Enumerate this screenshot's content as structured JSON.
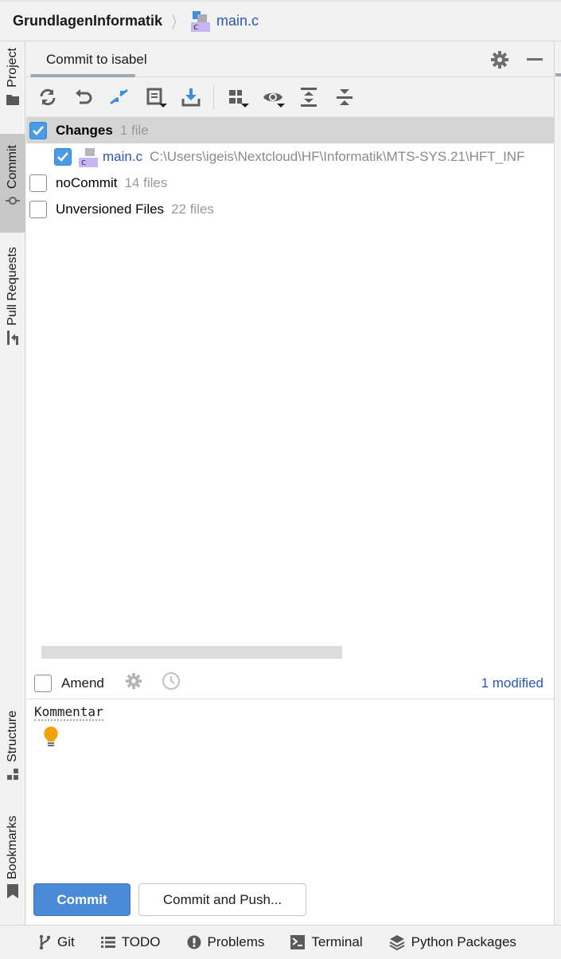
{
  "navbar": {
    "project": "GrundlagenInformatik",
    "separator": "〉",
    "file_icon_letter": "c",
    "file": "main.c"
  },
  "left_strip": {
    "tabs": [
      {
        "label": "Project",
        "icon": "folder-icon",
        "active": false
      },
      {
        "label": "Commit",
        "icon": "commit-icon",
        "active": true
      },
      {
        "label": "Pull Requests",
        "icon": "pull-request-icon",
        "active": false
      },
      {
        "label": "Structure",
        "icon": "structure-icon",
        "active": false
      },
      {
        "label": "Bookmarks",
        "icon": "bookmark-icon",
        "active": false
      }
    ]
  },
  "tool_window": {
    "tab_label": "Commit to isabel",
    "toolbar": [
      {
        "name": "refresh",
        "icon": "refresh-icon"
      },
      {
        "name": "rollback",
        "icon": "undo-icon"
      },
      {
        "name": "show-diff",
        "icon": "diff-arrows-icon"
      },
      {
        "name": "changelist",
        "icon": "changelist-icon"
      },
      {
        "name": "update",
        "icon": "download-icon"
      },
      {
        "name": "group-by",
        "icon": "group-icon"
      },
      {
        "name": "view-options",
        "icon": "eye-icon"
      },
      {
        "name": "expand-all",
        "icon": "expand-all-icon"
      },
      {
        "name": "collapse-all",
        "icon": "collapse-all-icon"
      }
    ]
  },
  "tree": {
    "changes": {
      "label": "Changes",
      "count": "1 file",
      "checked": true
    },
    "file": {
      "name": "main.c",
      "icon_letter": "c",
      "path": "C:\\Users\\igeis\\Nextcloud\\HF\\Informatik\\MTS-SYS.21\\HFT_INF",
      "checked": true
    },
    "nocommit": {
      "label": "noCommit",
      "count": "14 files",
      "checked": false
    },
    "unversioned": {
      "label": "Unversioned Files",
      "count": "22 files",
      "checked": false
    }
  },
  "amend": {
    "label": "Amend",
    "checked": false,
    "modified": "1 modified"
  },
  "message": {
    "text": "Kommentar"
  },
  "buttons": {
    "commit": "Commit",
    "commit_push": "Commit and Push..."
  },
  "bottom_bar": [
    {
      "label": "Git",
      "icon": "git-branch-icon"
    },
    {
      "label": "TODO",
      "icon": "list-icon"
    },
    {
      "label": "Problems",
      "icon": "problems-icon"
    },
    {
      "label": "Terminal",
      "icon": "terminal-icon"
    },
    {
      "label": "Python Packages",
      "icon": "layers-icon"
    }
  ],
  "colors": {
    "accent": "#4a8bd8",
    "link": "#2a56b4",
    "selection": "#d5d5d5",
    "bulb": "#f0a30a"
  }
}
